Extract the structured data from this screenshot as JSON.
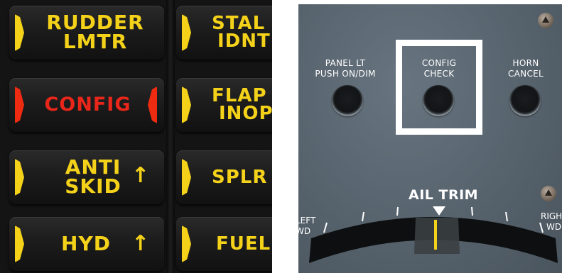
{
  "annunciator_panel": {
    "left_column": [
      {
        "lines": [
          "RUDDER",
          "LMTR"
        ],
        "lamp_color": "#f5d21a",
        "text_color": "#f5d21a",
        "arrow": ""
      },
      {
        "lines": [
          "CONFIG"
        ],
        "lamp_color": "#ef2b12",
        "text_color": "#e8261a",
        "arrow": ""
      },
      {
        "lines": [
          "ANTI",
          "SKID"
        ],
        "lamp_color": "#f5d21a",
        "text_color": "#f5d21a",
        "arrow": "↑"
      },
      {
        "lines": [
          "HYD"
        ],
        "lamp_color": "#f5d21a",
        "text_color": "#f5d21a",
        "arrow": "↑"
      }
    ],
    "right_column": [
      {
        "lines": [
          "STAL",
          "IDNT"
        ]
      },
      {
        "lines": [
          "FLAP",
          "INOP"
        ]
      },
      {
        "lines": [
          "SPLR"
        ]
      },
      {
        "lines": [
          "FUEL"
        ]
      }
    ]
  },
  "control_panel": {
    "buttons": [
      {
        "label_lines": [
          "PANEL LT",
          "PUSH ON/DIM"
        ]
      },
      {
        "label_lines": [
          "CONFIG",
          "CHECK"
        ]
      },
      {
        "label_lines": [
          "HORN",
          "CANCEL"
        ]
      }
    ],
    "highlighted_button": "CONFIG CHECK",
    "trim": {
      "title": "AIL TRIM",
      "left_label": [
        "LEFT",
        "WD"
      ],
      "right_label": [
        "RIGH",
        "WD"
      ]
    },
    "colors": {
      "panel": "#56626c",
      "highlight": "#ffffff",
      "trim_indicator": "#f5d21a"
    }
  }
}
